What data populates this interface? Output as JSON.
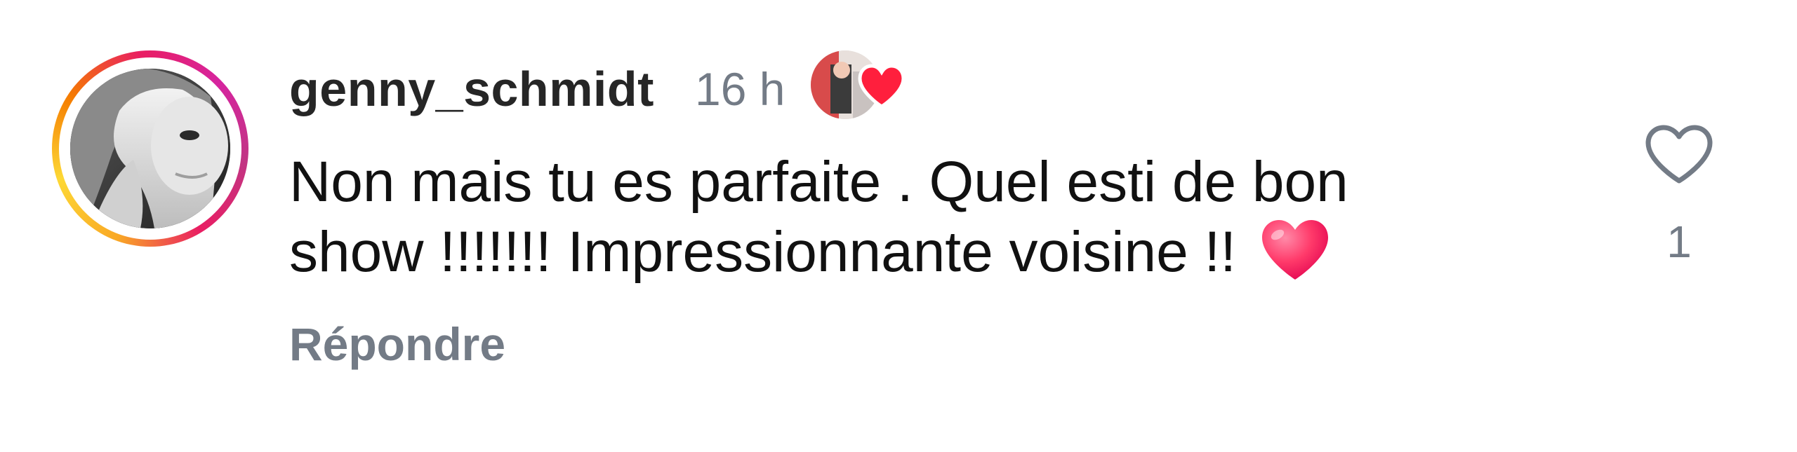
{
  "comment": {
    "username": "genny_schmidt",
    "timestamp": "16 h",
    "text": "Non mais tu es parfaite . Quel esti de bon show !!!!!!! Impressionnante voisine !! ",
    "reply_label": "Répondre",
    "like_count": "1"
  },
  "icons": {
    "avatar": "user-avatar-photo",
    "creator_like": "creator-liked-heart-icon",
    "like": "heart-outline-icon",
    "emoji": "red-heart-emoji"
  },
  "colors": {
    "text": "#111111",
    "muted": "#737b86",
    "heart_red": "#ff2d55",
    "ring_start": "#f9a825",
    "ring_end": "#d6249f"
  }
}
